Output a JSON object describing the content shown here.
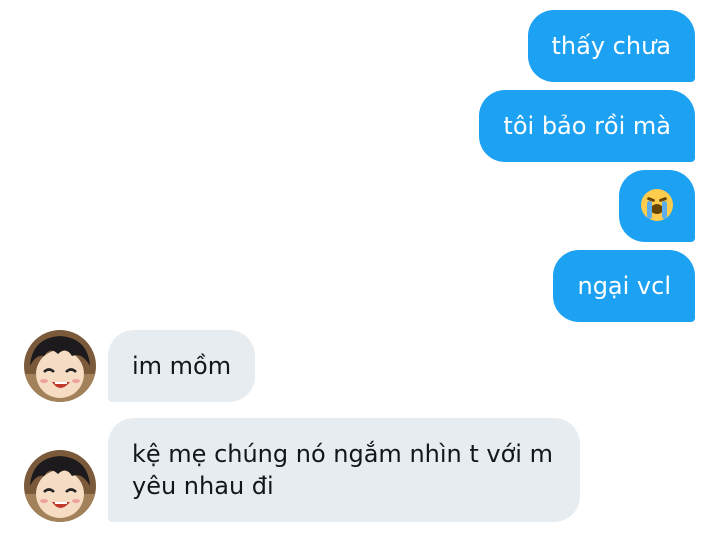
{
  "conversation": {
    "sent": [
      {
        "text": "thấy chưa"
      },
      {
        "text": "tôi bảo rồi mà"
      },
      {
        "emoji": "loudly-crying-face"
      },
      {
        "text": "ngại vcl"
      }
    ],
    "received": [
      {
        "text": "im mồm"
      },
      {
        "text": "kệ mẹ chúng nó ngắm nhìn t với m yêu nhau đi"
      }
    ]
  },
  "colors": {
    "sent_bubble": "#1da1f2",
    "received_bubble": "#e6ecf0",
    "sent_text": "#ffffff",
    "received_text": "#14171a"
  },
  "icons": {
    "avatar": "anime-character-avatar",
    "emoji": "loudly-crying-face-icon"
  }
}
